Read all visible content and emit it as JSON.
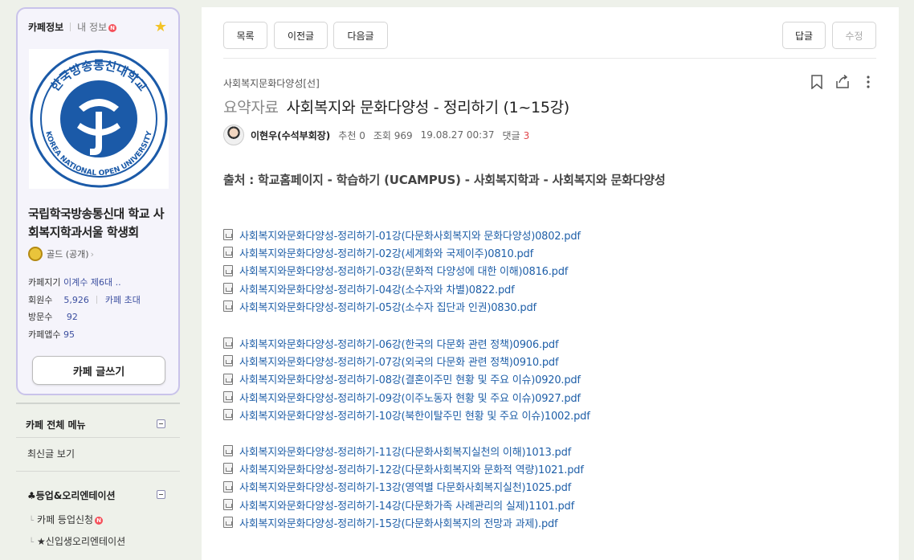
{
  "sidebar": {
    "tab_cafe_info": "카페정보",
    "tab_my_info": "내 정보",
    "new_badge": "N",
    "cafe_name": "국립학국방송통신대 학교 사회복지학과서울 학생회",
    "logo_text_top": "한국방송통신대학교",
    "logo_text_bottom": "KOREA NATIONAL OPEN UNIVERSITY",
    "grade": "골드 (공개)",
    "manager_label": "카페지기",
    "manager_value": "이계수 제6대 ..",
    "members_label": "회원수",
    "members_value": "5,926",
    "invite_label": "카페 초대",
    "visits_label": "방문수",
    "visits_value": "92",
    "app_label": "카페앱수",
    "app_value": "95",
    "write_button": "카페 글쓰기",
    "menu_all": "카페 전체 메뉴",
    "menu_recent": "최신글 보기",
    "menu_group": "♣등업&오리엔테이션",
    "menu_levelup": "카페 등업신청",
    "menu_orientation": "★신입생오리엔테이션"
  },
  "toolbar": {
    "list": "목록",
    "prev": "이전글",
    "next": "다음글",
    "reply": "답글",
    "edit": "수정"
  },
  "post": {
    "board": "사회복지문화다양성[선]",
    "head": "요약자료",
    "title": "사회복지와 문화다양성 - 정리하기 (1~15강)",
    "author": "이현우(수석부회장)",
    "recommend": "추천 0",
    "views": "조회 969",
    "date": "19.08.27 00:37",
    "comments_label": "댓글",
    "comments_count": "3",
    "source": "출처 : 학교홈페이지 - 학습하기 (UCAMPUS) - 사회복지학과 - 사회복지와 문화다양성"
  },
  "files": [
    "사회복지와문화다양성-정리하기-01강(다문화사회복지와 문화다양성)0802.pdf",
    "사회복지와문화다양성-정리하기-02강(세계화와 국제이주)0810.pdf",
    "사회복지와문화다양성-정리하기-03강(문화적 다양성에 대한 이해)0816.pdf",
    "사회복지와문화다양성-정리하기-04강(소수자와 차별)0822.pdf",
    "사회복지와문화다양성-정리하기-05강(소수자 집단과 인권)0830.pdf",
    "사회복지와문화다양성-정리하기-06강(한국의 다문화 관련 정책)0906.pdf",
    "사회복지와문화다양성-정리하기-07강(외국의 다문화 관련 정책)0910.pdf",
    "사회복지와문화다양성-정리하기-08강(결혼이주민 현황 및 주요 이슈)0920.pdf",
    "사회복지와문화다양성-정리하기-09강(이주노동자 현황 및 주요 이슈)0927.pdf",
    "사회복지와문화다양성-정리하기-10강(북한이탈주민 현황 및 주요 이슈)1002.pdf",
    "사회복지와문화다양성-정리하기-11강(다문화사회복지실천의 이해)1013.pdf",
    "사회복지와문화다양성-정리하기-12강(다문화사회복지와 문화적 역량)1021.pdf",
    "사회복지와문화다양성-정리하기-13강(영역별 다문화사회복지실천)1025.pdf",
    "사회복지와문화다양성-정리하기-14강(다문화가족 사례관리의 실제)1101.pdf",
    "사회복지와문화다양성-정리하기-15강(다문화사회복지의 전망과 과제).pdf"
  ]
}
